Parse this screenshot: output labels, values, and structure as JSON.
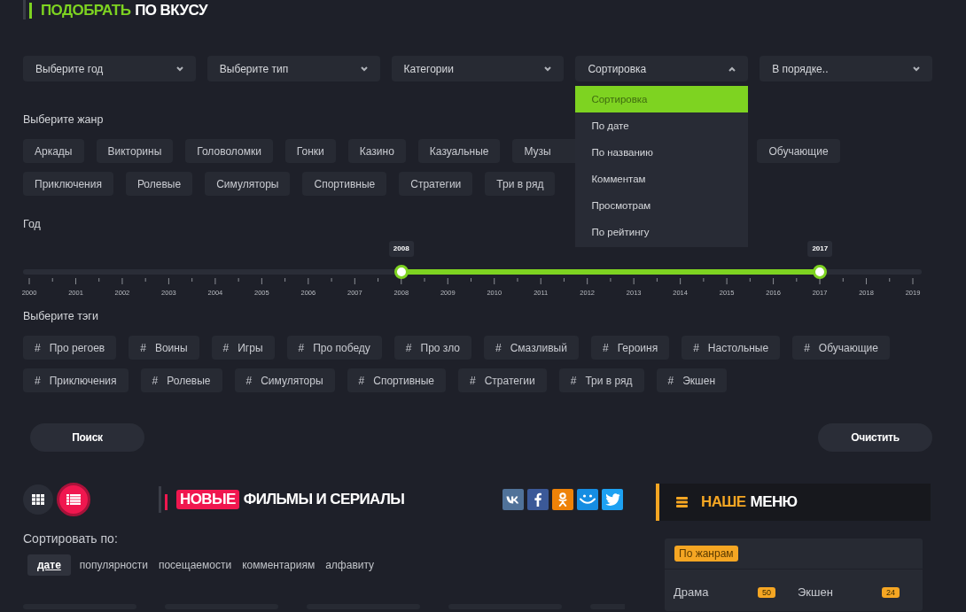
{
  "filter_title": {
    "accent": "ПОДОБРАТЬ",
    "rest": "ПО ВКУСУ"
  },
  "selects": [
    {
      "value": "Выберите год",
      "expanded": false
    },
    {
      "value": "Выберите тип",
      "expanded": false
    },
    {
      "value": "Категории",
      "expanded": false
    },
    {
      "value": "Сортировка",
      "expanded": true,
      "options": [
        {
          "label": "Сортировка",
          "selected": true
        },
        {
          "label": "По дате",
          "selected": false
        },
        {
          "label": "По названию",
          "selected": false
        },
        {
          "label": "Комментам",
          "selected": false
        },
        {
          "label": "Просмотрам",
          "selected": false
        },
        {
          "label": "По рейтингу",
          "selected": false
        }
      ]
    },
    {
      "value": "В порядке..",
      "expanded": false
    }
  ],
  "genre_label": "Выберите жанр",
  "genre_rows": [
    [
      {
        "label": "Аркады",
        "kind": "chip"
      },
      {
        "label": "Викторины",
        "kind": "chip"
      },
      {
        "label": "Головоломки",
        "kind": "chip"
      },
      {
        "label": "Гонки",
        "kind": "chip"
      },
      {
        "label": "Казино",
        "kind": "chip"
      },
      {
        "label": "Казуальные",
        "kind": "chip"
      },
      {
        "label": "Музы",
        "kind": "covered"
      },
      {
        "label": "Обучающие",
        "kind": "chip"
      }
    ],
    [
      {
        "label": "Приключения",
        "kind": "chip"
      },
      {
        "label": "Ролевые",
        "kind": "chip"
      },
      {
        "label": "Симуляторы",
        "kind": "chip"
      },
      {
        "label": "Спортивные",
        "kind": "chip"
      },
      {
        "label": "Стратегии",
        "kind": "chip"
      },
      {
        "label": "Три в ряд",
        "kind": "chip"
      }
    ]
  ],
  "year_label": "Год",
  "year_slider": {
    "thumbs": [
      {
        "reading": "2008",
        "level": 0.421
      },
      {
        "reading": "2017",
        "level": 0.895
      }
    ],
    "ticks": [
      "2000",
      "2001",
      "2002",
      "2003",
      "2004",
      "2005",
      "2006",
      "2007",
      "2008",
      "2009",
      "2010",
      "2011",
      "2012",
      "2013",
      "2014",
      "2015",
      "2016",
      "2017",
      "2018",
      "2019"
    ]
  },
  "tags_label": "Выберите тэги",
  "tag_rows": [
    [
      {
        "hash": "#",
        "label": "Про регоев"
      },
      {
        "hash": "#",
        "label": "Воины"
      },
      {
        "hash": "#",
        "label": "Игры"
      },
      {
        "hash": "#",
        "label": "Про победу"
      },
      {
        "hash": "#",
        "label": "Про зло"
      },
      {
        "hash": "#",
        "label": "Смазливый"
      },
      {
        "hash": "#",
        "label": "Героиня"
      },
      {
        "hash": "#",
        "label": "Настольные"
      },
      {
        "hash": "#",
        "label": "Обучающие"
      }
    ],
    [
      {
        "hash": "#",
        "label": "Приключения"
      },
      {
        "hash": "#",
        "label": "Ролевые"
      },
      {
        "hash": "#",
        "label": "Симуляторы"
      },
      {
        "hash": "#",
        "label": "Спортивные"
      },
      {
        "hash": "#",
        "label": "Стратегии"
      },
      {
        "hash": "#",
        "label": "Три в ряд"
      },
      {
        "hash": "#",
        "label": "Экшен"
      }
    ]
  ],
  "buttons": [
    "Поиск",
    "Очистить"
  ],
  "view_toggle": [
    {
      "kind": "grid",
      "selected": false
    },
    {
      "kind": "list",
      "selected": true
    }
  ],
  "news_title": {
    "accent": "НОВЫЕ",
    "rest": "ФИЛЬМЫ И СЕРИАЛЫ"
  },
  "share_buttons": [
    {
      "kind": "vk",
      "color": "#507299"
    },
    {
      "kind": "facebook",
      "color": "#3b5998"
    },
    {
      "kind": "ok",
      "color": "#ee8208"
    },
    {
      "kind": "smile",
      "color": "#168de2"
    },
    {
      "kind": "twitter",
      "color": "#1da1f2"
    }
  ],
  "sort_label": "Сортировать по:",
  "sort_options": [
    {
      "label": "дате",
      "selected": true
    },
    {
      "label": "популярности",
      "selected": false
    },
    {
      "label": "посещаемости",
      "selected": false
    },
    {
      "label": "комментариям",
      "selected": false
    },
    {
      "label": "алфавиту",
      "selected": false
    }
  ],
  "cards": [
    {
      "kind": "placeholder"
    },
    {
      "kind": "placeholder"
    },
    {
      "kind": "placeholder"
    },
    {
      "kind": "placeholder"
    },
    {
      "kind": "placeholder"
    }
  ],
  "menu": {
    "title": {
      "accent": "НАШЕ",
      "rest": "МЕНЮ"
    },
    "group": "По жанрам",
    "items": [
      {
        "label": "Драма",
        "count": "50"
      },
      {
        "label": "Экшен",
        "count": "24"
      }
    ]
  }
}
